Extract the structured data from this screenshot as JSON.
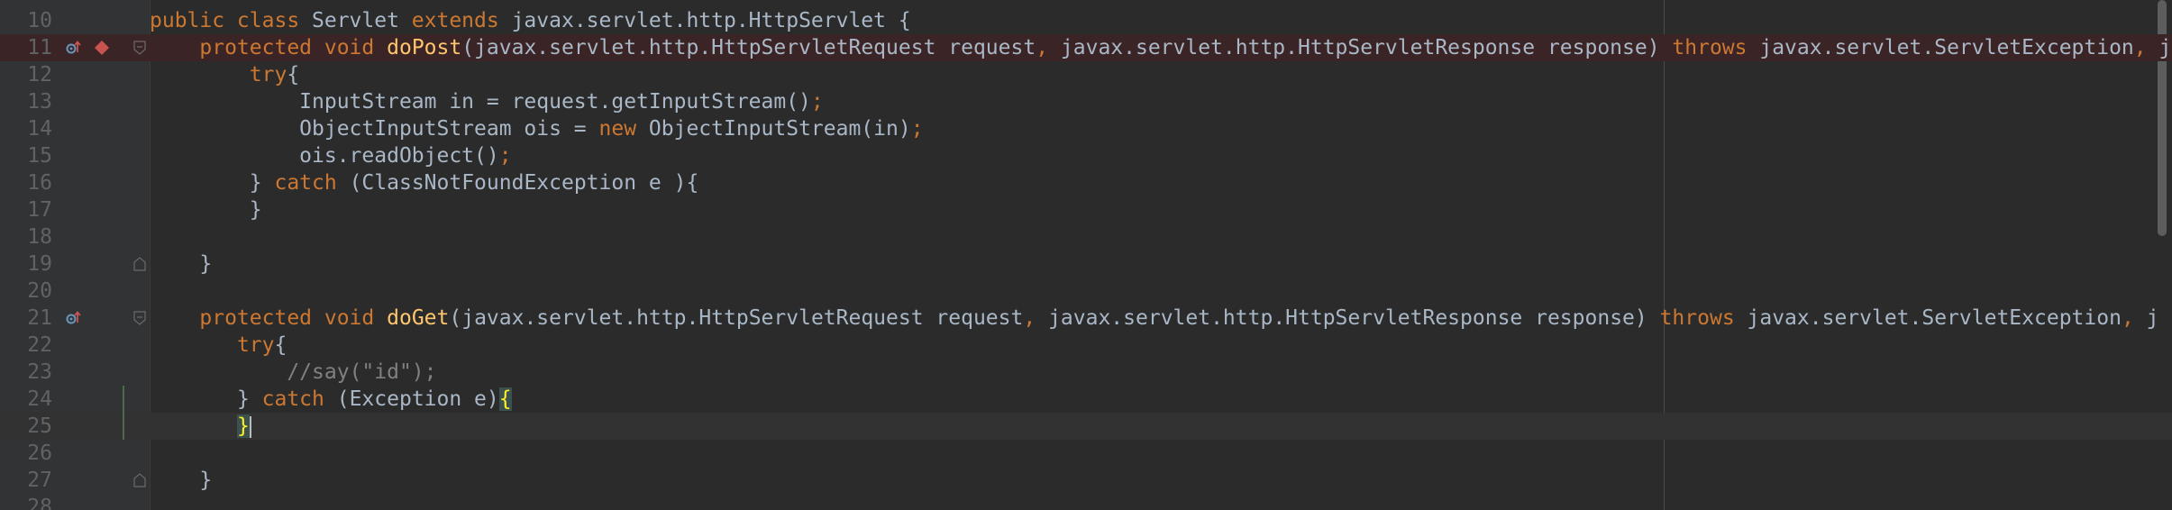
{
  "editor": {
    "theme": "darcula",
    "colors": {
      "background": "#2b2b2b",
      "keyword": "#cc7832",
      "method": "#ffc66d",
      "comment": "#808080",
      "breakpoint": "#c75450",
      "override_marker": "#6897bb"
    },
    "lines": [
      {
        "n": "10",
        "ind": "",
        "a": "public class",
        "b": " Servlet ",
        "c": "extends",
        "d": " javax.servlet.http.HttpServlet {"
      },
      {
        "n": "11",
        "ind": "    ",
        "a": "protected void",
        "b": " ",
        "c": "doPost",
        "d": "(javax.servlet.http.HttpServletRequest request",
        "e": ",",
        "f": " javax.servlet.http.HttpServletResponse response) ",
        "g": "throws",
        "h": " javax.servlet.ServletException",
        "i": ",",
        "j": " j"
      },
      {
        "n": "12",
        "ind": "        ",
        "a": "try",
        "b": "{"
      },
      {
        "n": "13",
        "ind": "            ",
        "a": "InputStream in = request.getInputStream()",
        "b": ";"
      },
      {
        "n": "14",
        "ind": "            ",
        "a": "ObjectInputStream ois = ",
        "b": "new",
        "c": " ObjectInputStream(in)",
        "d": ";"
      },
      {
        "n": "15",
        "ind": "            ",
        "a": "ois.readObject()",
        "b": ";"
      },
      {
        "n": "16",
        "ind": "        ",
        "a": "} ",
        "b": "catch",
        "c": " (ClassNotFoundException e ){"
      },
      {
        "n": "17",
        "ind": "        ",
        "a": "}"
      },
      {
        "n": "18"
      },
      {
        "n": "19",
        "ind": "    ",
        "a": "}"
      },
      {
        "n": "20"
      },
      {
        "n": "21",
        "ind": "    ",
        "a": "protected void",
        "b": " ",
        "c": "doGet",
        "d": "(javax.servlet.http.HttpServletRequest request",
        "e": ",",
        "f": " javax.servlet.http.HttpServletResponse response) ",
        "g": "throws",
        "h": " javax.servlet.ServletException",
        "i": ",",
        "j": " j"
      },
      {
        "n": "22",
        "ind": "       ",
        "a": "try",
        "b": "{"
      },
      {
        "n": "23",
        "ind": "           ",
        "a": "//say(\"id\");"
      },
      {
        "n": "24",
        "ind": "       ",
        "a": "} ",
        "b": "catch",
        "c": " (Exception e)",
        "d": "{"
      },
      {
        "n": "25",
        "ind": "       ",
        "a": "}"
      },
      {
        "n": "26"
      },
      {
        "n": "27",
        "ind": "    ",
        "a": "}"
      },
      {
        "n": "28"
      }
    ]
  }
}
